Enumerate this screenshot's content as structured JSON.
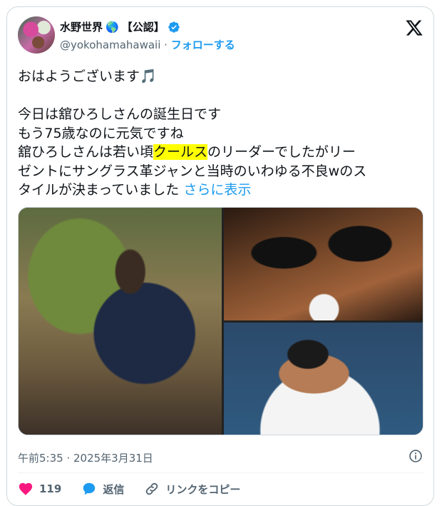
{
  "author": {
    "name": "水野世界",
    "globe_emoji": "🌎",
    "badge": "【公認】",
    "handle": "@yokohamahawaii",
    "separator": " · ",
    "follow_label": "フォローする"
  },
  "tweet": {
    "line1": "おはようございます🎵",
    "line2": "今日は舘ひろしさんの誕生日です",
    "line3": "もう75歳なのに元気ですね",
    "line4_pre": "舘ひろしさんは若い頃",
    "line4_highlight": "クールス",
    "line4_post": "のリーダーでしたがリー",
    "line5": "ゼントにサングラス革ジャンと当時のいわゆる不良wのス",
    "line6": "タイルが決まっていました ",
    "show_more": "さらに表示"
  },
  "meta": {
    "timestamp": "午前5:35 · 2025年3月31日"
  },
  "actions": {
    "like_count": "119",
    "reply_label": "返信",
    "copy_link_label": "リンクをコピー"
  },
  "colors": {
    "accent": "#1d9bf0",
    "like": "#f91880",
    "highlight": "#ffff00"
  }
}
